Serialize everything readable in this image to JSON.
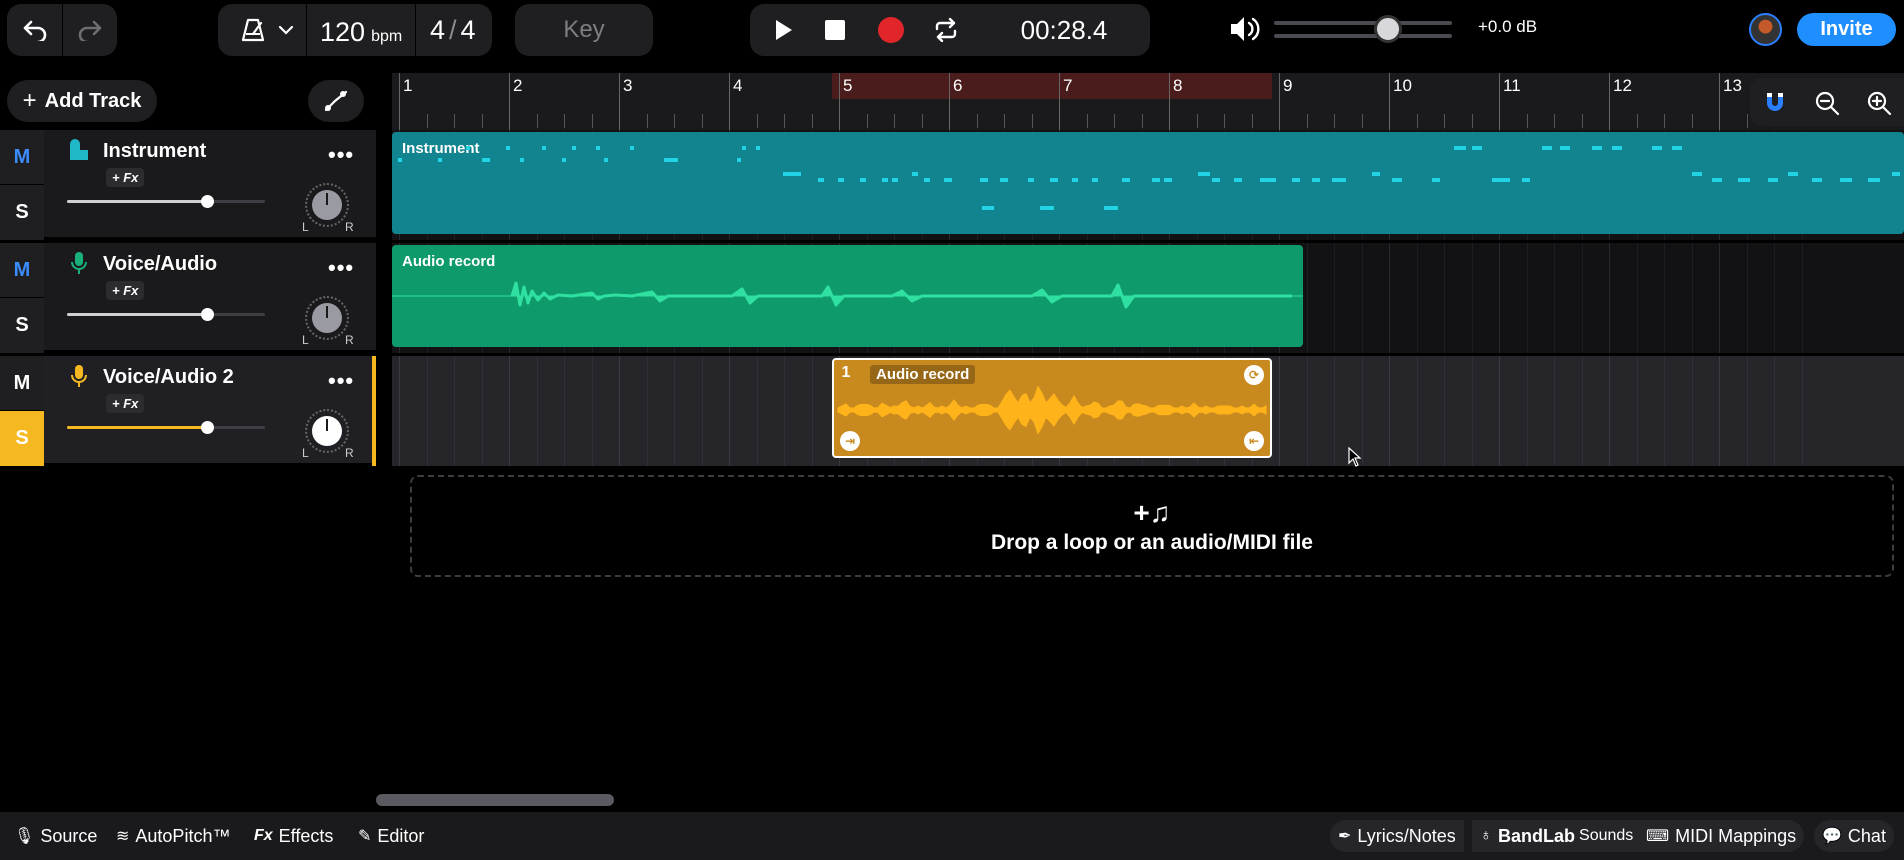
{
  "toolbar": {
    "bpm": "120",
    "bpm_unit": "bpm",
    "sig_num": "4",
    "sig_den": "4",
    "key_label": "Key",
    "time": "00:28.4",
    "db": "+0.0 dB",
    "invite": "Invite"
  },
  "sidebar": {
    "add_track": "Add Track"
  },
  "tracks": [
    {
      "name": "Instrument",
      "fx": "+ Fx",
      "mute": "M",
      "solo": "S",
      "pan_l": "L",
      "pan_r": "R"
    },
    {
      "name": "Voice/Audio",
      "fx": "+ Fx",
      "mute": "M",
      "solo": "S",
      "pan_l": "L",
      "pan_r": "R"
    },
    {
      "name": "Voice/Audio 2",
      "fx": "+ Fx",
      "mute": "M",
      "solo": "S",
      "pan_l": "L",
      "pan_r": "R"
    }
  ],
  "ruler": {
    "bars": [
      "1",
      "2",
      "3",
      "4",
      "5",
      "6",
      "7",
      "8",
      "9",
      "10",
      "11",
      "12",
      "13"
    ]
  },
  "clips": {
    "instrument": "Instrument",
    "audio1": "Audio record",
    "audio2_num": "1",
    "audio2": "Audio record"
  },
  "dropzone": {
    "text": "Drop a loop or an audio/MIDI file"
  },
  "bottom": {
    "source": "Source",
    "autopitch": "AutoPitch™",
    "effects": "Effects",
    "editor": "Editor",
    "lyrics": "Lyrics/Notes",
    "sounds_a": "BandLab",
    "sounds_b": "Sounds",
    "midi": "MIDI Mappings",
    "chat": "Chat"
  },
  "colors": {
    "instrument": "#12848f",
    "audio": "#0e9a6a",
    "audio2": "#c88a1e",
    "accent": "#1f8fff",
    "solo": "#f5b820"
  }
}
